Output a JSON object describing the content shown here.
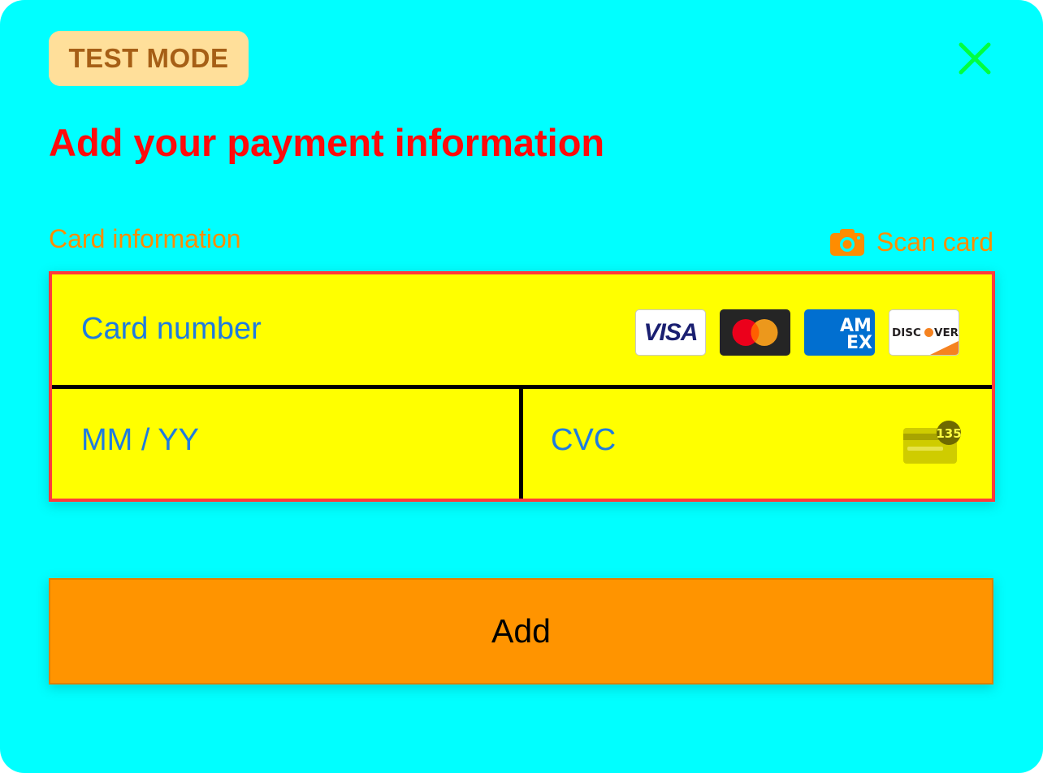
{
  "badge": {
    "label": "TEST MODE"
  },
  "close": {
    "icon": "close-icon",
    "color": "#00ff40"
  },
  "header": {
    "title": "Add your payment information"
  },
  "card_section": {
    "label": "Card information",
    "scan_label": "Scan card",
    "scan_icon": "camera-icon"
  },
  "form": {
    "card_number_placeholder": "Card number",
    "expiry_placeholder": "MM / YY",
    "cvc_placeholder": "CVC",
    "cvc_icon_text": "135",
    "brands": [
      {
        "name": "visa-logo",
        "text": "VISA"
      },
      {
        "name": "mastercard-logo",
        "text": ""
      },
      {
        "name": "amex-logo",
        "text": "AMEX"
      },
      {
        "name": "discover-logo",
        "text": "DISCOVER"
      }
    ]
  },
  "actions": {
    "add_label": "Add"
  },
  "colors": {
    "background": "#00ffff",
    "title": "#ff0a0a",
    "accent": "#ff8c00",
    "field_bg": "#ffff00",
    "field_border": "#ff3b3b",
    "placeholder": "#1e7be0",
    "button": "#ff9400",
    "badge_bg": "#ffdf9a",
    "badge_text": "#a65f16"
  }
}
